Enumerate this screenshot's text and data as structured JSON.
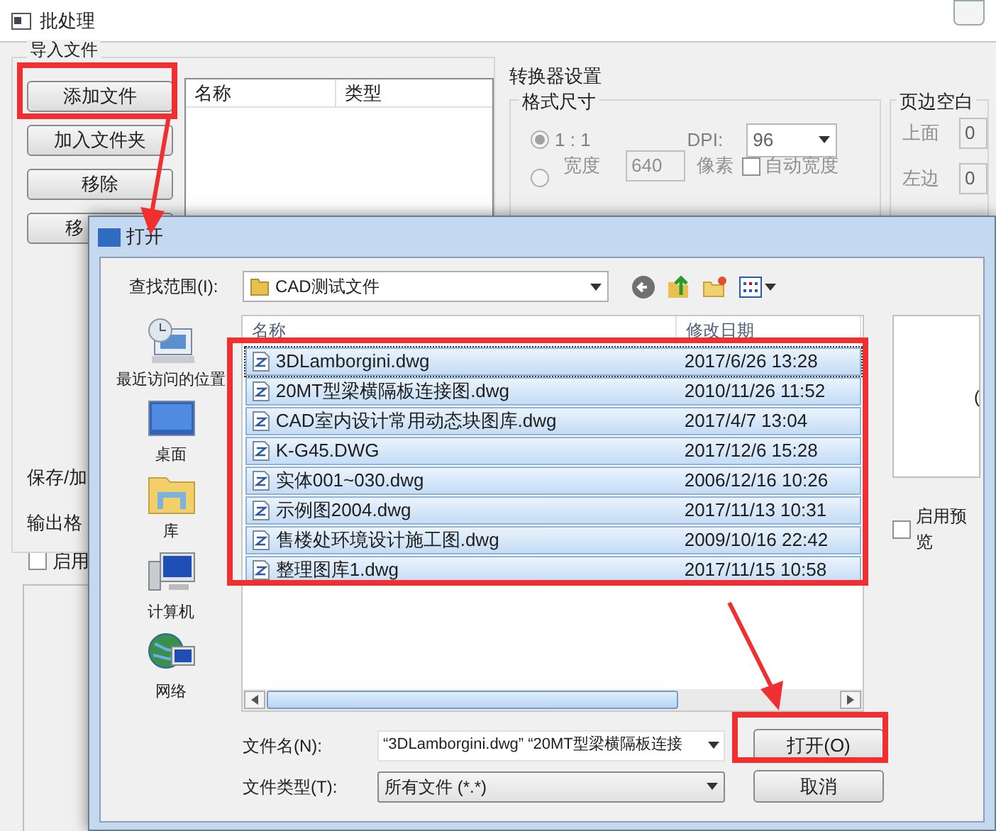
{
  "window": {
    "title": "批处理"
  },
  "import_group": {
    "title": "导入文件",
    "buttons": [
      "添加文件",
      "加入文件夹",
      "移除",
      "移"
    ],
    "list_columns": [
      "名称",
      "类型"
    ],
    "side_labels": [
      "保存/加",
      "输出格"
    ],
    "enable": {
      "label": "启用",
      "checked": false
    }
  },
  "converter": {
    "title": "转换器设置",
    "format_title": "格式尺寸",
    "radio_1": {
      "label": "1 : 1",
      "selected": true
    },
    "radio_2": {
      "selected": false
    },
    "dpi_label": "DPI:",
    "dpi_value": "96",
    "width_label": "宽度",
    "width_value": "640",
    "width_unit": "像素",
    "auto_width": {
      "label": "自动宽度",
      "checked": false
    }
  },
  "margins": {
    "title": "页边空白",
    "rows": [
      {
        "label": "上面",
        "value": "0"
      },
      {
        "label": "左边",
        "value": "0"
      }
    ]
  },
  "dialog": {
    "title": "打开",
    "look_in_label": "查找范围(I):",
    "look_in_value": "CAD测试文件",
    "places": [
      {
        "label": "最近访问的位置",
        "kind": "recent"
      },
      {
        "label": "桌面",
        "kind": "desktop"
      },
      {
        "label": "库",
        "kind": "library"
      },
      {
        "label": "计算机",
        "kind": "computer"
      },
      {
        "label": "网络",
        "kind": "network"
      }
    ],
    "columns": [
      "名称",
      "修改日期"
    ],
    "files": [
      {
        "name": "3DLamborgini.dwg",
        "date": "2017/6/26 13:28",
        "selected": true
      },
      {
        "name": "20MT型梁横隔板连接图.dwg",
        "date": "2010/11/26 11:52",
        "selected": true
      },
      {
        "name": "CAD室内设计常用动态块图库.dwg",
        "date": "2017/4/7 13:04",
        "selected": true
      },
      {
        "name": "K-G45.DWG",
        "date": "2017/12/6 15:28",
        "selected": true
      },
      {
        "name": "实体001~030.dwg",
        "date": "2006/12/16 10:26",
        "selected": true
      },
      {
        "name": "示例图2004.dwg",
        "date": "2017/11/13 10:31",
        "selected": true
      },
      {
        "name": "售楼处环境设计施工图.dwg",
        "date": "2009/10/16 22:42",
        "selected": true
      },
      {
        "name": "整理图库1.dwg",
        "date": "2017/11/15 10:58",
        "selected": true
      }
    ],
    "preview_text": "(",
    "preview_checkbox": {
      "label": "启用预览",
      "checked": false
    },
    "file_name_label": "文件名(N):",
    "file_name_value": "“3DLamborgini.dwg” “20MT型梁横隔板连接",
    "file_type_label": "文件类型(T):",
    "file_type_value": "所有文件 (*.*)",
    "buttons": [
      "打开(O)",
      "取消"
    ]
  }
}
